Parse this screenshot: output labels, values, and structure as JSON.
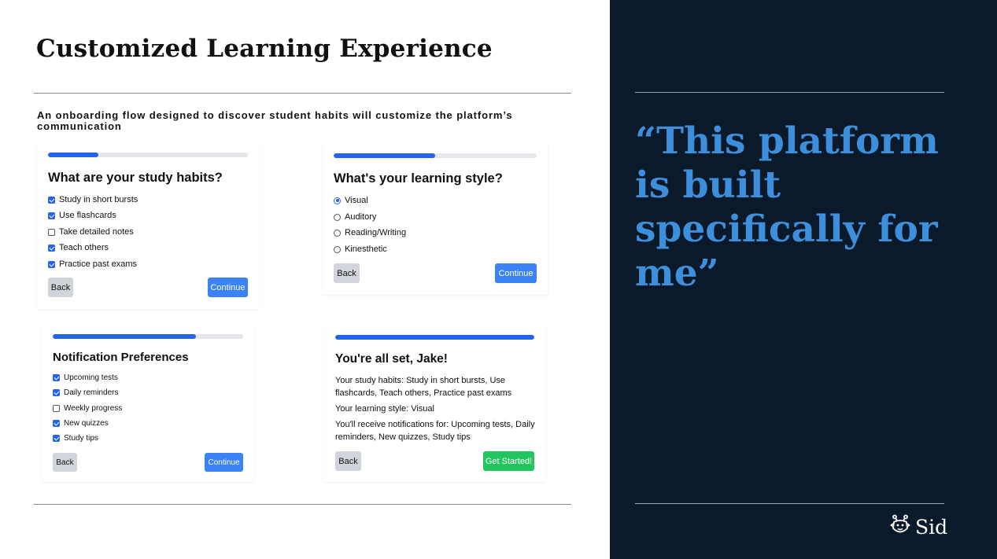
{
  "slide": {
    "title": "Customized Learning Experience",
    "subtitle": "An onboarding flow designed to discover student habits will customize the platform’s communication"
  },
  "study_habits": {
    "progress": 0.25,
    "question": "What are your study habits?",
    "options": [
      {
        "label": "Study in short bursts",
        "checked": true
      },
      {
        "label": "Use flashcards",
        "checked": true
      },
      {
        "label": "Take detailed notes",
        "checked": false
      },
      {
        "label": "Teach others",
        "checked": true
      },
      {
        "label": "Practice past exams",
        "checked": true
      }
    ],
    "back_label": "Back",
    "continue_label": "Continue"
  },
  "learning_style": {
    "progress": 0.5,
    "question": "What's your learning style?",
    "options": [
      {
        "label": "Visual",
        "selected": true
      },
      {
        "label": "Auditory",
        "selected": false
      },
      {
        "label": "Reading/Writing",
        "selected": false
      },
      {
        "label": "Kinesthetic",
        "selected": false
      }
    ],
    "back_label": "Back",
    "continue_label": "Continue"
  },
  "notifications": {
    "progress": 0.75,
    "question": "Notification Preferences",
    "options": [
      {
        "label": "Upcoming tests",
        "checked": true
      },
      {
        "label": "Daily reminders",
        "checked": true
      },
      {
        "label": "Weekly progress",
        "checked": false
      },
      {
        "label": "New quizzes",
        "checked": true
      },
      {
        "label": "Study tips",
        "checked": true
      }
    ],
    "back_label": "Back",
    "continue_label": "Continue"
  },
  "summary": {
    "progress": 1.0,
    "heading": "You're all set, Jake!",
    "habits_text": "Your study habits: Study in short bursts, Use flashcards, Teach others, Practice past exams",
    "style_text": "Your learning style: Visual",
    "notifications_text": "You'll receive notifications for: Upcoming tests, Daily reminders, New quizzes, Study tips",
    "back_label": "Back",
    "start_label": "Get Started!"
  },
  "quote": {
    "text": "“This platform is built specifically for me”"
  },
  "brand": {
    "name": "Sid",
    "icon": "robot-face-icon"
  },
  "colors": {
    "panel_bg": "#0b1a2a",
    "quote": "#3d8fdc",
    "progress": "#2563eb",
    "primary_button": "#3b82f6",
    "success_button": "#22c55e"
  }
}
